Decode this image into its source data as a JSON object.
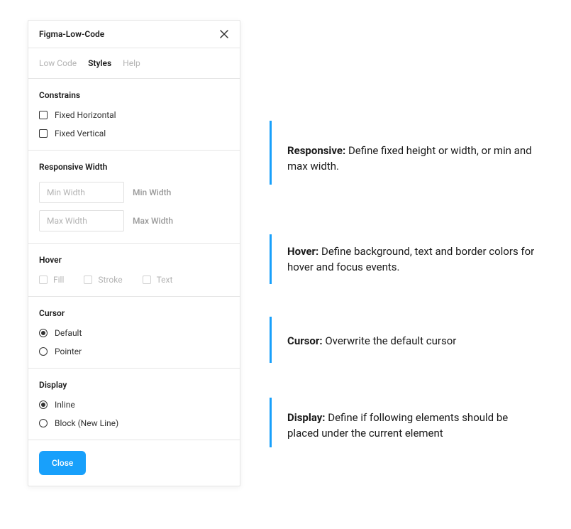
{
  "header": {
    "title": "Figma-Low-Code"
  },
  "tabs": {
    "lowcode": "Low Code",
    "styles": "Styles",
    "help": "Help"
  },
  "constrains": {
    "title": "Constrains",
    "fixed_horizontal": "Fixed Horizontal",
    "fixed_vertical": "Fixed Vertical"
  },
  "responsive": {
    "title": "Responsive Width",
    "min_placeholder": "Min Width",
    "min_label": "Min Width",
    "max_placeholder": "Max Width",
    "max_label": "Max Width"
  },
  "hover": {
    "title": "Hover",
    "fill": "Fill",
    "stroke": "Stroke",
    "text": "Text"
  },
  "cursor": {
    "title": "Cursor",
    "default": "Default",
    "pointer": "Pointer"
  },
  "display": {
    "title": "Display",
    "inline": "Inline",
    "block": "Block (New Line)"
  },
  "footer": {
    "close": "Close"
  },
  "annotations": {
    "responsive_label": "Responsive:",
    "responsive_body": " Define fixed height or width, or min and max width.",
    "hover_label": "Hover:",
    "hover_body": " Define background, text and border colors for hover and focus events.",
    "cursor_label": "Cursor:",
    "cursor_body": " Overwrite the default cursor",
    "display_label": "Display:",
    "display_body": " Define if following elements should be placed under the current element"
  }
}
